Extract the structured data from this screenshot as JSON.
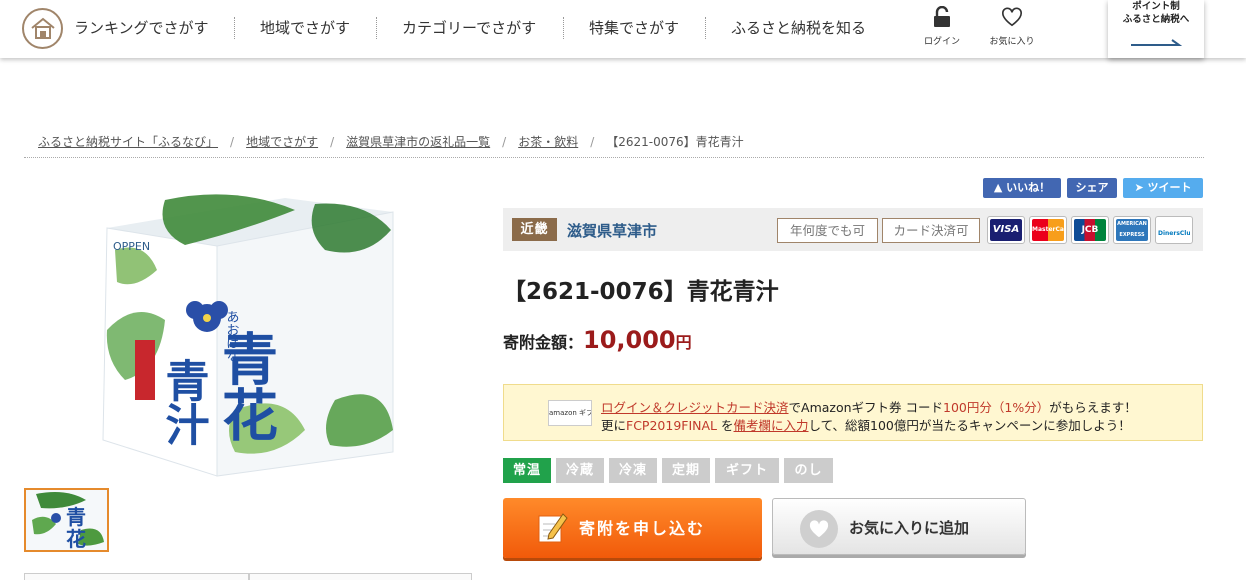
{
  "header": {
    "nav": [
      {
        "label": "ランキングでさがす"
      },
      {
        "label": "地域でさがす"
      },
      {
        "label": "カテゴリーでさがす"
      },
      {
        "label": "特集でさがす"
      },
      {
        "label": "ふるさと納税を知る"
      }
    ],
    "login_label": "ログイン",
    "favorites_label": "お気に入り",
    "point_line1": "ポイント制",
    "point_line2": "ふるさと納税へ"
  },
  "breadcrumb": [
    "ふるさと納税サイト「ふるなび」",
    "地域でさがす",
    "滋賀県草津市の返礼品一覧",
    "お茶・飲料",
    "【2621-0076】青花青汁"
  ],
  "social": {
    "like": "いいね！",
    "share": "シェア",
    "tweet": "ツイート"
  },
  "info": {
    "region": "近畿",
    "municipality": "滋賀県草津市",
    "tag_anytime": "年何度でも可",
    "tag_card": "カード決済可",
    "cards": [
      "VISA",
      "MasterCard",
      "JCB",
      "AMERICAN EXPRESS",
      "DinersClub"
    ]
  },
  "product": {
    "title": "【2621-0076】青花青汁",
    "price_label": "寄附金額：",
    "price_value": "10,000",
    "price_unit": "円",
    "image_brand": "OPPEN",
    "image_title": "青花青汁",
    "image_reading": "あおばな"
  },
  "campaign": {
    "amazon_logo": "amazon ギフト券",
    "l1_link": "ログイン＆クレジットカード決済",
    "l1_a": "でAmazonギフト券 コード",
    "l1_red": "100円分（1%分）",
    "l1_b": "がもらえます！",
    "l2_a": "更に",
    "l2_code": "FCP2019FINAL",
    "l2_b": " を",
    "l2_red": "備考欄に入力",
    "l2_c": "して、総額100億円が当たるキャンペーンに参加しよう！"
  },
  "temperature_tags": [
    "常温",
    "冷蔵",
    "冷凍",
    "定期",
    "ギフト",
    "のし"
  ],
  "buttons": {
    "apply": "寄附を申し込む",
    "favorite": "お気に入りに追加"
  },
  "colors": {
    "accent_orange": "#f15a0a",
    "price_red": "#9b1b1b",
    "active_tag_green": "#21a24b",
    "region_brown": "#8b6b4a"
  }
}
